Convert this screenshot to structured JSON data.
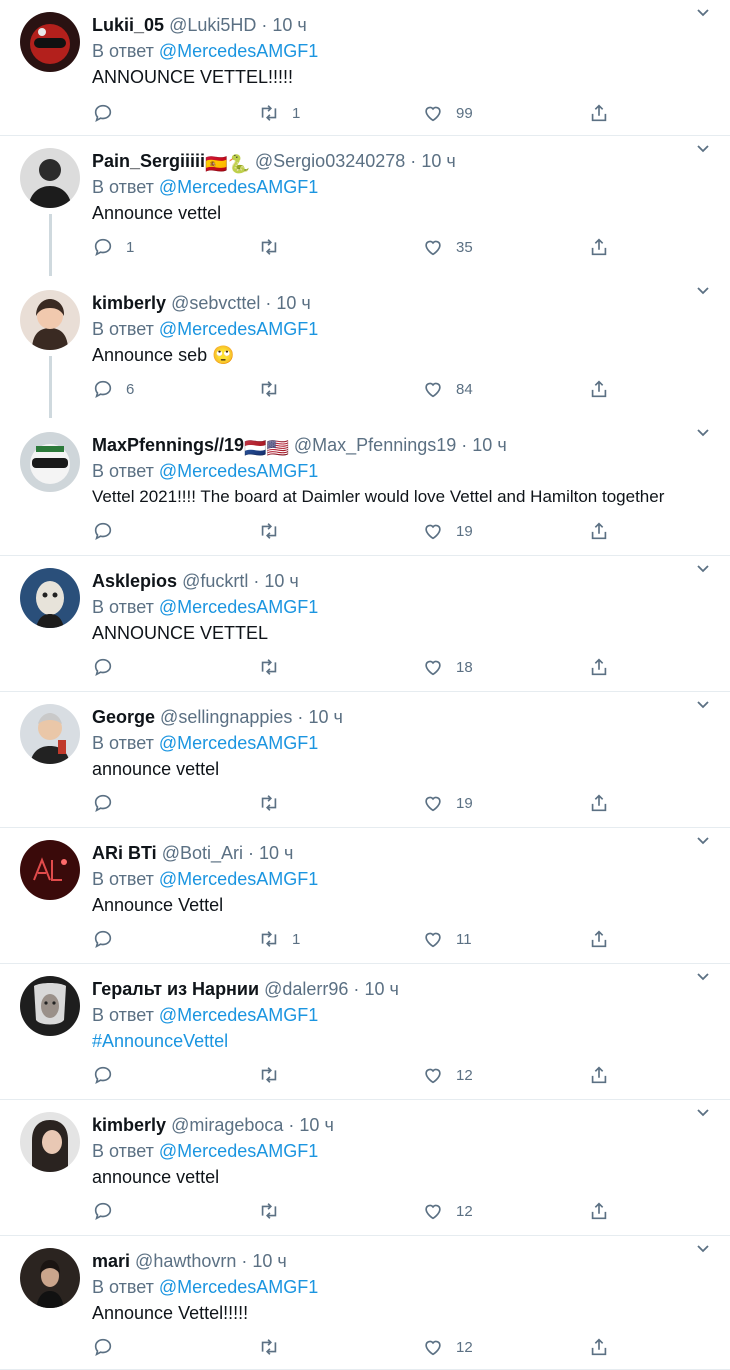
{
  "reply_prefix": "В ответ",
  "mention": "@MercedesAMGF1",
  "colors": {
    "accent": "#1b95e0",
    "muted": "#5b7083",
    "text": "#0f1419",
    "divider": "#e6ecf0"
  },
  "tweets": [
    {
      "name": "Lukii_05",
      "handle": "@Luki5HD",
      "sep": "·",
      "time": "10 ч",
      "text": "ANNOUNCE VETTEL!!!!!",
      "replies": "",
      "retweets": "1",
      "likes": "99",
      "avatar": "red-helmet-avatar"
    },
    {
      "name": "Pain_Sergiiiii",
      "flags": "🇪🇸🐍",
      "handle": "@Sergio03240278",
      "sep": "·",
      "time": "10 ч",
      "text": "Announce vettel",
      "replies": "1",
      "retweets": "",
      "likes": "35",
      "avatar": "bw-portrait-avatar"
    },
    {
      "name": "kimberly",
      "handle": "@sebvcttel",
      "sep": "·",
      "time": "10 ч",
      "text": "Announce seb 🙄",
      "replies": "6",
      "retweets": "",
      "likes": "84",
      "avatar": "woman-portrait-avatar"
    },
    {
      "name": "MaxPfennings//19",
      "flags": "🇳🇱🇺🇸",
      "handle": "@Max_Pfennings19",
      "sep": "·",
      "time": "10 ч",
      "text": "Vettel 2021!!!! The board at Daimler would love Vettel and Hamilton together",
      "replies": "",
      "retweets": "",
      "likes": "19",
      "avatar": "helmet-avatar"
    },
    {
      "name": "Asklepios",
      "handle": "@fuckrtl",
      "sep": "·",
      "time": "10 ч",
      "text": "ANNOUNCE VETTEL",
      "replies": "",
      "retweets": "",
      "likes": "18",
      "avatar": "mask-avatar"
    },
    {
      "name": "George",
      "handle": "@sellingnappies",
      "sep": "·",
      "time": "10 ч",
      "text": "announce vettel",
      "replies": "",
      "retweets": "",
      "likes": "19",
      "avatar": "selfie-avatar"
    },
    {
      "name": "ARi BTi",
      "handle": "@Boti_Ari",
      "sep": "·",
      "time": "10 ч",
      "text": "Announce Vettel",
      "replies": "",
      "retweets": "1",
      "likes": "11",
      "avatar": "red-logo-avatar"
    },
    {
      "name": "Геральт из Нарнии",
      "handle": "@dalerr96",
      "sep": "·",
      "time": "10 ч",
      "text": "#AnnounceVettel",
      "is_link": true,
      "replies": "",
      "retweets": "",
      "likes": "12",
      "avatar": "witcher-avatar"
    },
    {
      "name": "kimberly",
      "handle": "@mirageboca",
      "sep": "·",
      "time": "10 ч",
      "text": "announce vettel",
      "replies": "",
      "retweets": "",
      "likes": "12",
      "avatar": "woman-dark-hair-avatar"
    },
    {
      "name": "mari",
      "handle": "@hawthovrn",
      "sep": "·",
      "time": "10 ч",
      "text": "Announce Vettel!!!!!",
      "replies": "",
      "retweets": "",
      "likes": "12",
      "avatar": "dark-portrait-avatar"
    }
  ]
}
